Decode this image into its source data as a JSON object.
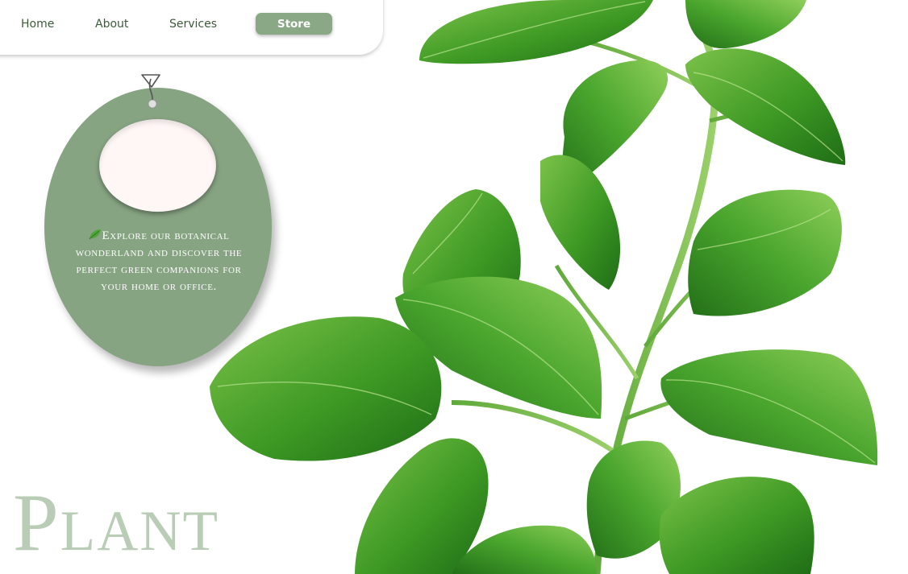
{
  "nav": {
    "items": [
      {
        "label": "Home"
      },
      {
        "label": "About"
      },
      {
        "label": "Services"
      }
    ],
    "cta_label": "Store"
  },
  "tag": {
    "icon": "leaf-icon",
    "text": "Explore our botanical wonderland and discover the perfect green companions for your home or office."
  },
  "hero": {
    "title": "Plant"
  },
  "colors": {
    "accent": "#86a382",
    "nav_text": "#3c5a3a",
    "title": "#b9cdb6",
    "leaf": "#3f9a2a"
  }
}
